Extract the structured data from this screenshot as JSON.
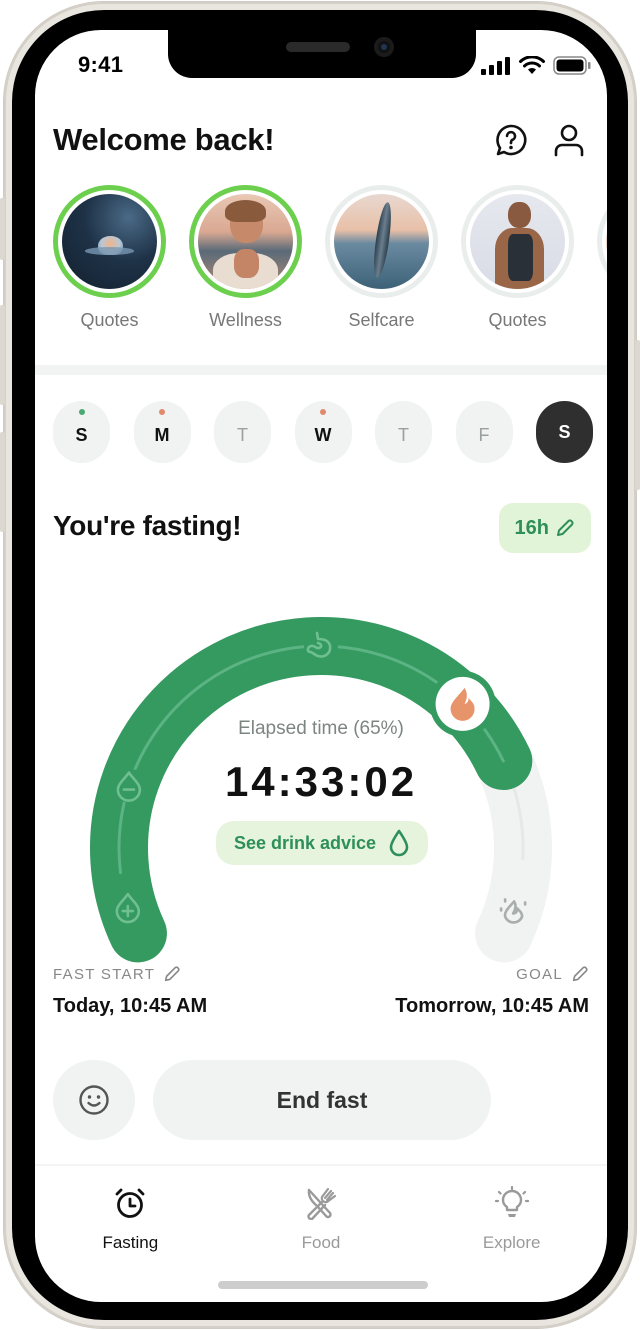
{
  "status_bar": {
    "time": "9:41"
  },
  "header": {
    "title": "Welcome back!",
    "help_icon": "help-chat-icon",
    "profile_icon": "user-icon"
  },
  "stories": [
    {
      "label": "Quotes",
      "image": "lotus-flower",
      "viewed": false
    },
    {
      "label": "Wellness",
      "image": "woman-meditating",
      "viewed": false
    },
    {
      "label": "Selfcare",
      "image": "feather-sunset",
      "viewed": true
    },
    {
      "label": "Quotes",
      "image": "woman-yoga",
      "viewed": true
    },
    {
      "label": "",
      "image": "partial-story",
      "viewed": true
    }
  ],
  "week": [
    {
      "letter": "S",
      "dot": "#4aa872",
      "muted": false,
      "selected": false
    },
    {
      "letter": "M",
      "dot": "#e08a6b",
      "muted": false,
      "selected": false
    },
    {
      "letter": "T",
      "dot": null,
      "muted": true,
      "selected": false
    },
    {
      "letter": "W",
      "dot": "#e08a6b",
      "muted": false,
      "selected": false
    },
    {
      "letter": "T",
      "dot": null,
      "muted": true,
      "selected": false
    },
    {
      "letter": "F",
      "dot": null,
      "muted": true,
      "selected": false
    },
    {
      "letter": "S",
      "dot": null,
      "muted": false,
      "selected": true
    }
  ],
  "fasting": {
    "title": "You're fasting!",
    "goal_pill": "16h",
    "elapsed_label": "Elapsed time (65%)",
    "progress": 0.65,
    "timer": "14:33:02",
    "drink_button": "See drink advice",
    "stages": [
      "blood-sugar-rise",
      "blood-sugar-drop",
      "digestion",
      "fat-burning",
      "ketosis"
    ],
    "start_label": "FAST START",
    "start_value": "Today, 10:45 AM",
    "goal_label": "GOAL",
    "goal_value": "Tomorrow, 10:45 AM",
    "end_button": "End fast"
  },
  "colors": {
    "accent": "#349a60",
    "track": "#f0f3f1",
    "story_ring_active": "#6cd04e",
    "pill_bg": "#e2f4d8",
    "flame": "#e8946b"
  },
  "tabs": [
    {
      "label": "Fasting",
      "icon": "alarm-clock-icon",
      "active": true
    },
    {
      "label": "Food",
      "icon": "fork-knife-icon",
      "active": false
    },
    {
      "label": "Explore",
      "icon": "lightbulb-icon",
      "active": false
    }
  ]
}
